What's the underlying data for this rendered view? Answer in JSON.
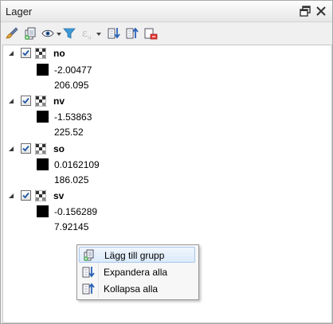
{
  "panel": {
    "title": "Lager",
    "float_icon": "float-icon",
    "close_icon": "close-icon"
  },
  "toolbar": {
    "icons": [
      "style-brush-icon",
      "add-group-icon",
      "visibility-eye-icon",
      "filter-icon",
      "expression-filter-icon",
      "expand-all-icon",
      "collapse-all-icon",
      "remove-layer-icon"
    ]
  },
  "layers": [
    {
      "name": "no",
      "min": "-2.00477",
      "max": "206.095"
    },
    {
      "name": "nv",
      "min": "-1.53863",
      "max": "225.52"
    },
    {
      "name": "so",
      "min": "0.0162109",
      "max": "186.025"
    },
    {
      "name": "sv",
      "min": "-0.156289",
      "max": "7.92145"
    }
  ],
  "context_menu": {
    "items": [
      {
        "label": "Lägg till grupp",
        "icon": "add-group-icon"
      },
      {
        "label": "Expandera alla",
        "icon": "expand-all-icon"
      },
      {
        "label": "Kollapsa alla",
        "icon": "collapse-all-icon"
      }
    ]
  },
  "colors": {
    "checkbox_mark": "#1f57a4",
    "swatch": "#000000",
    "menu_highlight": "#dbeafb"
  }
}
